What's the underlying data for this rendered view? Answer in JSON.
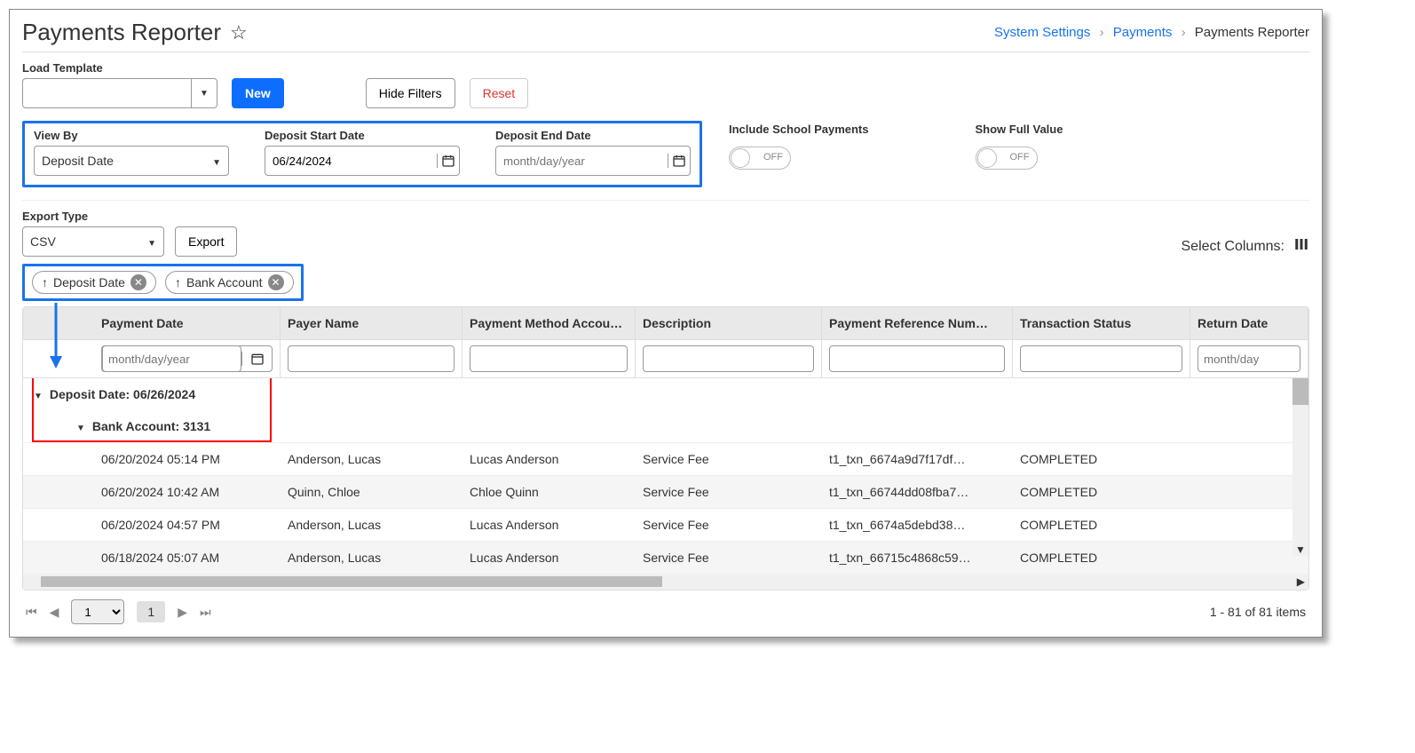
{
  "header": {
    "title": "Payments Reporter",
    "breadcrumb": {
      "item1": "System Settings",
      "item2": "Payments",
      "current": "Payments Reporter"
    }
  },
  "toolbar": {
    "load_template_label": "Load Template",
    "new_btn": "New",
    "hide_filters_btn": "Hide Filters",
    "reset_btn": "Reset"
  },
  "filters": {
    "view_by_label": "View By",
    "view_by_value": "Deposit Date",
    "deposit_start_label": "Deposit Start Date",
    "deposit_start_value": "06/24/2024",
    "deposit_end_label": "Deposit End Date",
    "deposit_end_placeholder": "month/day/year",
    "include_school_label": "Include School Payments",
    "show_full_label": "Show Full Value",
    "toggle_off": "OFF"
  },
  "export": {
    "label": "Export Type",
    "value": "CSV",
    "btn": "Export",
    "select_columns": "Select Columns:"
  },
  "chips": {
    "c1": "Deposit Date",
    "c2": "Bank Account"
  },
  "columns": {
    "payment_date": "Payment Date",
    "payer_name": "Payer Name",
    "method": "Payment Method Accou…",
    "description": "Description",
    "refnum": "Payment Reference Num…",
    "status": "Transaction Status",
    "return_date": "Return Date"
  },
  "col_filter": {
    "date_placeholder": "month/day/year",
    "return_placeholder": "month/day"
  },
  "groups": {
    "deposit": "Deposit Date: 06/26/2024",
    "bank": "Bank Account: 3131"
  },
  "rows": [
    {
      "date": "06/20/2024 05:14 PM",
      "payer": "Anderson, Lucas",
      "method": "Lucas Anderson",
      "desc": "Service Fee",
      "ref": "t1_txn_6674a9d7f17df…",
      "status": "COMPLETED"
    },
    {
      "date": "06/20/2024 10:42 AM",
      "payer": "Quinn, Chloe",
      "method": "Chloe Quinn",
      "desc": "Service Fee",
      "ref": "t1_txn_66744dd08fba7…",
      "status": "COMPLETED"
    },
    {
      "date": "06/20/2024 04:57 PM",
      "payer": "Anderson, Lucas",
      "method": "Lucas Anderson",
      "desc": "Service Fee",
      "ref": "t1_txn_6674a5debd38…",
      "status": "COMPLETED"
    },
    {
      "date": "06/18/2024 05:07 AM",
      "payer": "Anderson, Lucas",
      "method": "Lucas Anderson",
      "desc": "Service Fee",
      "ref": "t1_txn_66715c4868c59…",
      "status": "COMPLETED"
    }
  ],
  "pager": {
    "page_value": "1",
    "current": "1",
    "summary": "1 - 81 of 81 items"
  }
}
